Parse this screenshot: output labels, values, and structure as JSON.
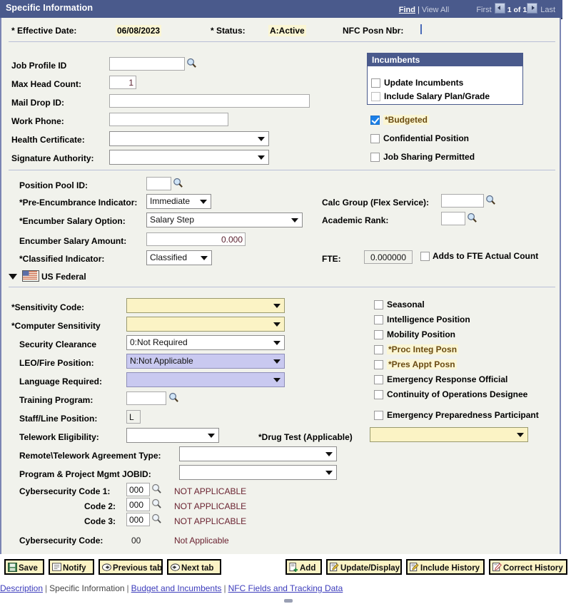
{
  "header": {
    "title": "Specific Information",
    "find_label": "Find",
    "view_all_label": "View All",
    "first_label": "First",
    "count_label": "1 of 1",
    "last_label": "Last",
    "prev_icon": "chevron-left-icon",
    "next_icon": "chevron-right-icon"
  },
  "keyrow": {
    "effective_date_label": "* Effective Date:",
    "effective_date_value": "06/08/2023",
    "status_label": "* Status:",
    "status_value": "A:Active",
    "nfc_posn_label": "NFC Posn Nbr:",
    "nfc_posn_value": ""
  },
  "left_top": {
    "job_profile_id_label": "Job Profile ID",
    "job_profile_id_value": "",
    "max_head_count_label": "Max Head Count:",
    "max_head_count_value": "1",
    "mail_drop_id_label": "Mail Drop ID:",
    "mail_drop_id_value": "",
    "work_phone_label": "Work Phone:",
    "work_phone_value": "",
    "health_certificate_label": "Health Certificate:",
    "health_certificate_value": "",
    "signature_authority_label": "Signature Authority:",
    "signature_authority_value": ""
  },
  "incumbents": {
    "title": "Incumbents",
    "update_incumbents_label": "Update Incumbents",
    "update_incumbents_checked": false,
    "include_salary_plan_grade_label": "Include Salary Plan/Grade",
    "include_salary_plan_grade_checked": false
  },
  "right_checks": {
    "budgeted_label": "*Budgeted",
    "budgeted_checked": true,
    "confidential_position_label": "Confidential Position",
    "confidential_position_checked": false,
    "job_sharing_permitted_label": "Job Sharing Permitted",
    "job_sharing_permitted_checked": false
  },
  "encumbrance": {
    "position_pool_id_label": "Position Pool ID:",
    "position_pool_id_value": "",
    "pre_encumbrance_label": "*Pre-Encumbrance Indicator:",
    "pre_encumbrance_value": "Immediate",
    "encumber_salary_option_label": "*Encumber Salary Option:",
    "encumber_salary_option_value": "Salary Step",
    "encumber_salary_amount_label": "Encumber Salary Amount:",
    "encumber_salary_amount_value": "0.000",
    "classified_indicator_label": "*Classified Indicator:",
    "classified_indicator_value": "Classified",
    "calc_group_label": "Calc Group (Flex Service):",
    "calc_group_value": "",
    "academic_rank_label": "Academic Rank:",
    "academic_rank_value": "",
    "fte_label": "FTE:",
    "fte_value": "0.000000",
    "adds_to_fte_label": "Adds to FTE Actual Count",
    "adds_to_fte_checked": false
  },
  "us_federal": {
    "section_title": "US Federal",
    "flag_icon": "us-flag-icon",
    "collapse_icon": "caret-down-icon",
    "sensitivity_code_label": "*Sensitivity Code:",
    "sensitivity_code_value": "",
    "computer_sensitivity_label": "*Computer Sensitivity",
    "computer_sensitivity_value": "",
    "security_clearance_label": "Security Clearance",
    "security_clearance_value": "0:Not Required",
    "leo_fire_position_label": "LEO/Fire Position:",
    "leo_fire_position_value": "N:Not Applicable",
    "language_required_label": "Language Required:",
    "language_required_value": "",
    "training_program_label": "Training Program:",
    "training_program_value": "",
    "staff_line_position_label": "Staff/Line Position:",
    "staff_line_position_value": "L",
    "telework_eligibility_label": "Telework Eligibility:",
    "telework_eligibility_value": "",
    "remote_telework_agreement_label": "Remote\\Telework Agreement Type:",
    "remote_telework_agreement_value": "",
    "program_project_mgmt_label": "Program & Project Mgmt JOBID:",
    "program_project_mgmt_value": "",
    "drug_test_label": "*Drug Test (Applicable)",
    "drug_test_value": ""
  },
  "federal_checks": [
    {
      "label": "Seasonal",
      "checked": false,
      "highlight": false
    },
    {
      "label": "Intelligence Position",
      "checked": false,
      "highlight": false
    },
    {
      "label": "Mobility Position",
      "checked": false,
      "highlight": false
    },
    {
      "label": "*Proc Integ Posn",
      "checked": false,
      "highlight": true
    },
    {
      "label": "*Pres Appt Posn",
      "checked": false,
      "highlight": true
    },
    {
      "label": "Emergency Response Official",
      "checked": false,
      "highlight": false
    },
    {
      "label": "Continuity of Operations Designee",
      "checked": false,
      "highlight": false
    },
    {
      "label": "Emergency Preparedness Participant",
      "checked": false,
      "highlight": false
    }
  ],
  "cybersecurity": {
    "code1_label": "Cybersecurity Code 1:",
    "code1_value": "000",
    "code1_desc": "NOT APPLICABLE",
    "code2_label": "Code 2:",
    "code2_value": "000",
    "code2_desc": "NOT APPLICABLE",
    "code3_label": "Code 3:",
    "code3_value": "000",
    "code3_desc": "NOT APPLICABLE",
    "summary_label": "Cybersecurity Code:",
    "summary_value": "00",
    "summary_desc": "Not Applicable"
  },
  "toolbar": {
    "save_label": "Save",
    "notify_label": "Notify",
    "previous_tab_label": "Previous tab",
    "next_tab_label": "Next tab",
    "add_label": "Add",
    "update_display_label": "Update/Display",
    "include_history_label": "Include History",
    "correct_history_label": "Correct History"
  },
  "footer_links": {
    "description": "Description",
    "specific_information": "Specific Information",
    "budget_and_incumbents": "Budget and Incumbents",
    "nfc_fields": "NFC Fields and Tracking Data",
    "separator": "|"
  },
  "colors": {
    "header_blue": "#4a5a8c",
    "panel_bg": "#f1f2ec",
    "highlight_yellow": "#fbf6d4",
    "required_yellow": "#fbf3c5",
    "purple_field": "#c9c9f0",
    "link_blue": "#3b3bbb",
    "maroon_text": "#6a2230"
  }
}
